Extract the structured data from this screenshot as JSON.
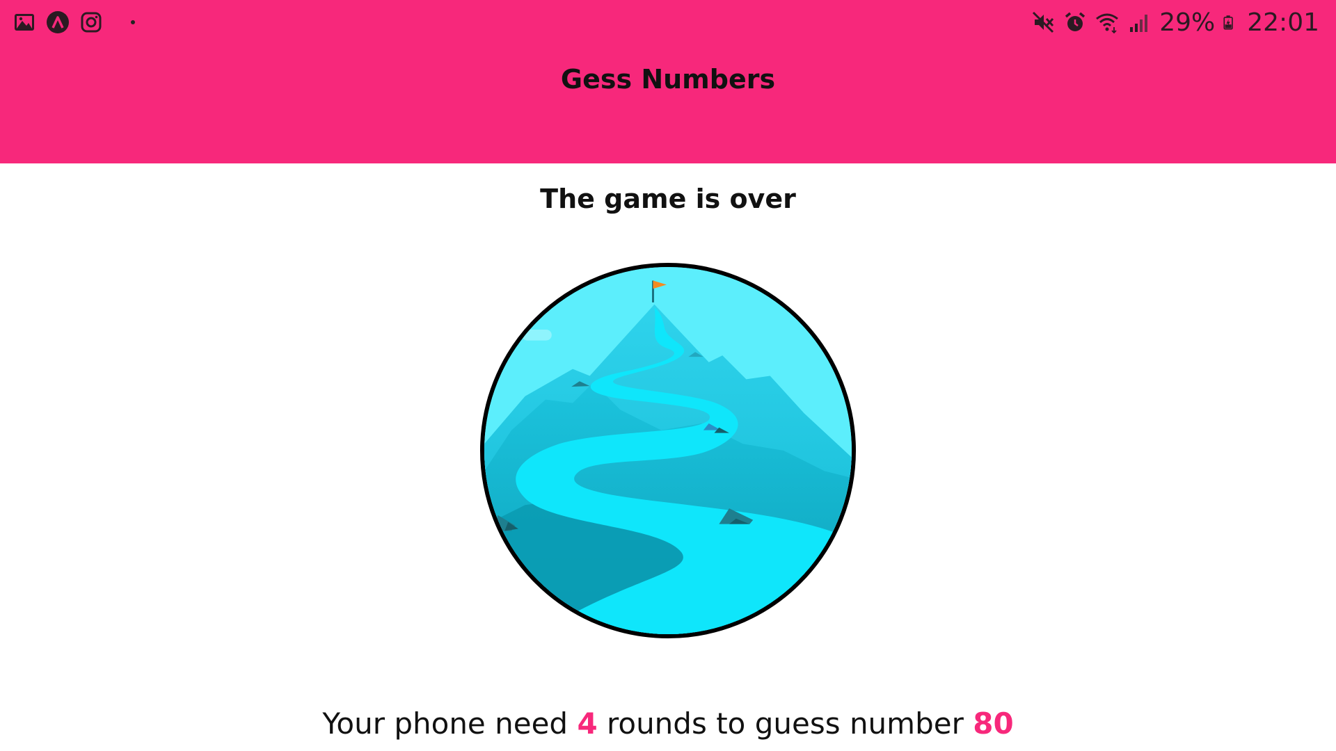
{
  "status_bar": {
    "left_icons": [
      "gallery-icon",
      "app-a-icon",
      "instagram-icon",
      "notification-dot-icon"
    ],
    "right_icons": [
      "mute-icon",
      "alarm-icon",
      "wifi-icon",
      "signal-icon",
      "battery-charging-icon"
    ],
    "battery": "29%",
    "time": "22:01"
  },
  "header": {
    "title": "Gess Numbers",
    "background_color": "#f7287b"
  },
  "main": {
    "title": "The game is over",
    "image_icon": "mountain-summit-illustration",
    "result": {
      "prefix": "Your phone need ",
      "rounds": "4",
      "middle": " rounds to guess number ",
      "number": "80"
    },
    "accent_color": "#f7287b"
  }
}
